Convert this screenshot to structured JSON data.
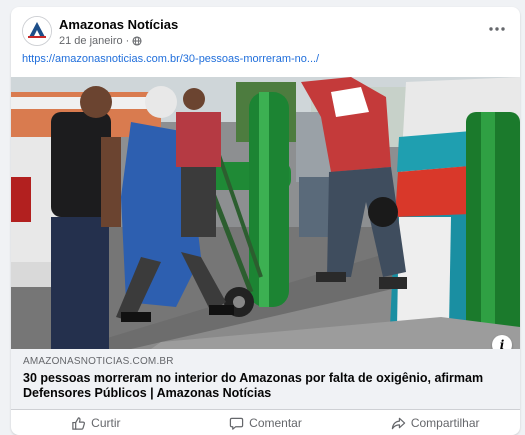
{
  "post": {
    "page_name": "Amazonas Notícias",
    "date": "21 de janeiro",
    "dot": "·",
    "link_url": "https://amazonasnoticias.com.br/30-pessoas-morreram-no.../",
    "preview": {
      "domain": "AMAZONASNOTICIAS.COM.BR",
      "title": "30 pessoas morreram no interior do Amazonas por falta de oxigênio, afirmam Defensores Públicos | Amazonas Notícias"
    },
    "photo_icon": "info-icon",
    "more_icon": "more-horizontal-icon",
    "privacy_icon": "globe-icon"
  },
  "actions": {
    "like_label": "Curtir",
    "comment_label": "Comentar",
    "share_label": "Compartilhar"
  },
  "colors": {
    "link": "#216fdb",
    "brand": "#1d4e89",
    "background": "#f0f2f5",
    "text_secondary": "#65676b"
  }
}
